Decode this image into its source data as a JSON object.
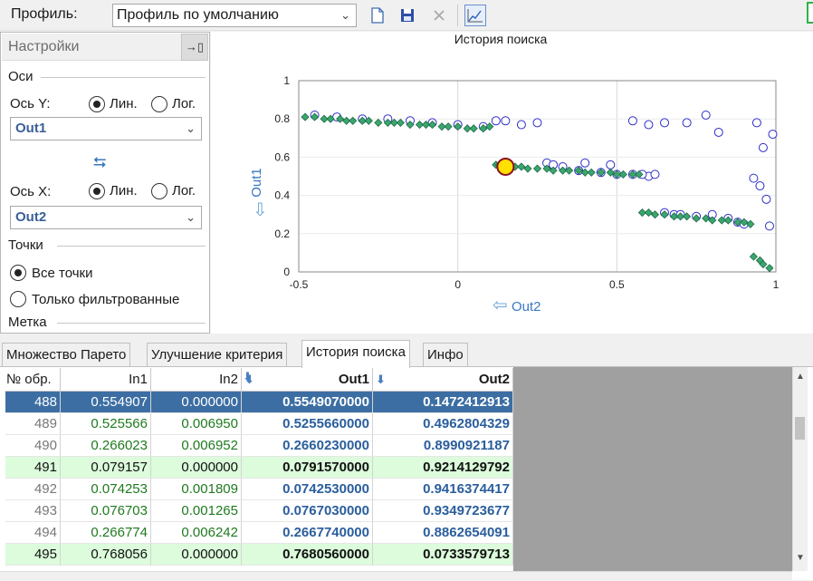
{
  "toolbar": {
    "profile_label": "Профиль:",
    "profile_value": "Профиль по умолчанию",
    "icons": [
      "new-file-icon",
      "save-icon",
      "close-icon",
      "chart-icon"
    ]
  },
  "settings": {
    "title": "Настройки",
    "axes_group": "Оси",
    "y_axis_label": "Ось Y:",
    "x_axis_label": "Ось X:",
    "linear": "Лин.",
    "log": "Лог.",
    "y_value": "Out1",
    "x_value": "Out2",
    "swap_symbol": "⮀",
    "points_group": "Точки",
    "all_points": "Все точки",
    "filtered_only": "Только фильтрованные",
    "label_group": "Метка"
  },
  "chart": {
    "title": "История поиска",
    "xlabel": "Out2",
    "ylabel": "Out1",
    "xticks": [
      "-0.5",
      "0",
      "0.5",
      "1"
    ],
    "yticks": [
      "0",
      "0.2",
      "0.4",
      "0.6",
      "0.8",
      "1"
    ]
  },
  "chart_data": {
    "type": "scatter",
    "title": "История поиска",
    "xlabel": "Out2",
    "ylabel": "Out1",
    "xlim": [
      -0.5,
      1
    ],
    "ylim": [
      0,
      1
    ],
    "grid": true,
    "series": [
      {
        "values_note": "",
        "x": [
          -0.48,
          -0.45,
          -0.42,
          -0.4,
          -0.37,
          -0.35,
          -0.33,
          -0.3,
          -0.28,
          -0.25,
          -0.22,
          -0.2,
          -0.18,
          -0.15,
          -0.12,
          -0.1,
          -0.08,
          -0.05,
          -0.03,
          0.0,
          0.03,
          0.05,
          0.08,
          0.1,
          0.12,
          0.13,
          0.15,
          0.18,
          0.2,
          0.22,
          0.25,
          0.28,
          0.3,
          0.33,
          0.35,
          0.38,
          0.4,
          0.42,
          0.45,
          0.48,
          0.5,
          0.52,
          0.55,
          0.57,
          0.58,
          0.6,
          0.62,
          0.65,
          0.68,
          0.7,
          0.72,
          0.75,
          0.78,
          0.8,
          0.83,
          0.85,
          0.88,
          0.9,
          0.92,
          0.93,
          0.95,
          0.96,
          0.98
        ],
        "y": [
          0.81,
          0.81,
          0.8,
          0.8,
          0.8,
          0.79,
          0.79,
          0.79,
          0.79,
          0.78,
          0.78,
          0.78,
          0.78,
          0.77,
          0.77,
          0.77,
          0.77,
          0.76,
          0.76,
          0.76,
          0.75,
          0.75,
          0.75,
          0.76,
          0.56,
          0.56,
          0.55,
          0.55,
          0.55,
          0.54,
          0.54,
          0.54,
          0.53,
          0.53,
          0.53,
          0.53,
          0.52,
          0.52,
          0.52,
          0.52,
          0.51,
          0.51,
          0.51,
          0.51,
          0.31,
          0.31,
          0.3,
          0.3,
          0.29,
          0.29,
          0.29,
          0.28,
          0.28,
          0.27,
          0.27,
          0.27,
          0.26,
          0.26,
          0.25,
          0.08,
          0.06,
          0.04,
          0.02
        ]
      },
      {
        "x": [
          -0.45,
          -0.38,
          -0.3,
          -0.22,
          -0.15,
          -0.08,
          0.0,
          0.08,
          0.12,
          0.15,
          0.2,
          0.25,
          0.28,
          0.3,
          0.33,
          0.38,
          0.4,
          0.45,
          0.48,
          0.5,
          0.55,
          0.6,
          0.62,
          0.65,
          0.68,
          0.7,
          0.75,
          0.8,
          0.85,
          0.88,
          0.9,
          0.93,
          0.95,
          0.97,
          0.98,
          0.99,
          0.55,
          0.6,
          0.65,
          0.72,
          0.78,
          0.82,
          0.94,
          0.96,
          0.58
        ],
        "y": [
          0.82,
          0.81,
          0.8,
          0.8,
          0.79,
          0.78,
          0.77,
          0.76,
          0.79,
          0.79,
          0.77,
          0.78,
          0.57,
          0.56,
          0.55,
          0.53,
          0.57,
          0.52,
          0.56,
          0.51,
          0.51,
          0.5,
          0.51,
          0.31,
          0.3,
          0.3,
          0.29,
          0.3,
          0.28,
          0.26,
          0.25,
          0.49,
          0.45,
          0.38,
          0.24,
          0.72,
          0.79,
          0.77,
          0.78,
          0.78,
          0.82,
          0.73,
          0.78,
          0.65,
          0.51
        ]
      },
      {
        "x": [
          0.15
        ],
        "y": [
          0.55
        ]
      }
    ]
  },
  "tabs": [
    "Множество Парето",
    "Улучшение критерия",
    "История поиска",
    "Инфо"
  ],
  "table": {
    "headers": [
      "№ обр.",
      "In1",
      "In2",
      "Out1",
      "Out2"
    ],
    "rows": [
      {
        "n": "488",
        "in1": "0.554907",
        "in2": "0.000000",
        "out1": "0.5549070000",
        "out2": "0.1472412913",
        "state": "selected"
      },
      {
        "n": "489",
        "in1": "0.525566",
        "in2": "0.006950",
        "out1": "0.5255660000",
        "out2": "0.4962804329",
        "state": "normal"
      },
      {
        "n": "490",
        "in1": "0.266023",
        "in2": "0.006952",
        "out1": "0.2660230000",
        "out2": "0.8990921187",
        "state": "normal"
      },
      {
        "n": "491",
        "in1": "0.079157",
        "in2": "0.000000",
        "out1": "0.0791570000",
        "out2": "0.9214129792",
        "state": "pareto"
      },
      {
        "n": "492",
        "in1": "0.074253",
        "in2": "0.001809",
        "out1": "0.0742530000",
        "out2": "0.9416374417",
        "state": "normal"
      },
      {
        "n": "493",
        "in1": "0.076703",
        "in2": "0.001265",
        "out1": "0.0767030000",
        "out2": "0.9349723677",
        "state": "normal"
      },
      {
        "n": "494",
        "in1": "0.266774",
        "in2": "0.006242",
        "out1": "0.2667740000",
        "out2": "0.8862654091",
        "state": "normal"
      },
      {
        "n": "495",
        "in1": "0.768056",
        "in2": "0.000000",
        "out1": "0.7680560000",
        "out2": "0.0733579713",
        "state": "pareto"
      }
    ]
  },
  "colors": {
    "selected_row": "#3c6ea3",
    "pareto_row": "#dcfcdc",
    "out_text": "#2a5e9c",
    "in_text": "#1f7a1f",
    "marker_green": "#3aa76d",
    "marker_circle": "#2e2ec8",
    "highlight": "#ffe000"
  }
}
